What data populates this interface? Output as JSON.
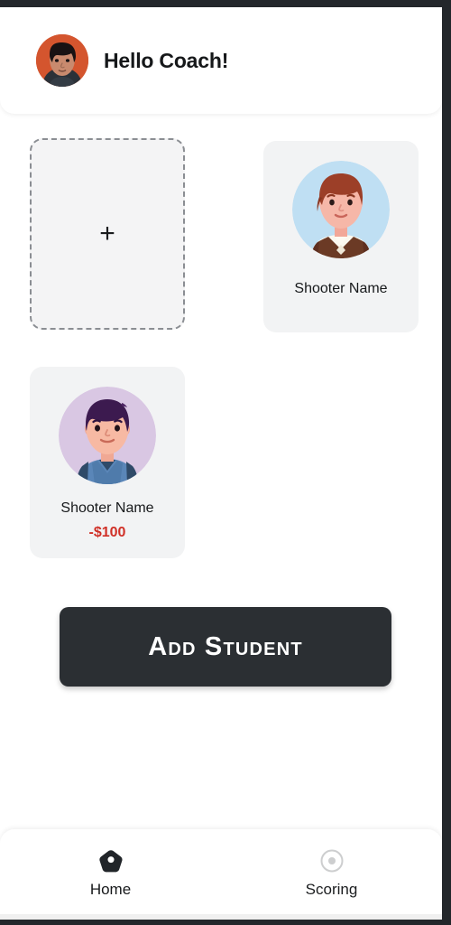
{
  "header": {
    "avatar_icon": "coach-photo-avatar",
    "greeting": "Hello Coach!"
  },
  "main": {
    "add_card": {
      "icon": "plus-icon",
      "label": "+"
    },
    "students": [
      {
        "avatar_icon": "student-avatar-boy-brown-hair",
        "name": "Shooter Name",
        "balance": ""
      },
      {
        "avatar_icon": "student-avatar-boy-purple-hair",
        "name": "Shooter Name",
        "balance": "-$100"
      }
    ],
    "add_student_button": "Add Student"
  },
  "bottom_nav": {
    "items": [
      {
        "label": "Home",
        "icon": "home-icon",
        "active": true
      },
      {
        "label": "Scoring",
        "icon": "target-icon",
        "active": false
      }
    ]
  },
  "colors": {
    "button_bg": "#2b2f33",
    "card_bg": "#f2f3f4",
    "negative_balance": "#d03027",
    "frame": "#23272b",
    "text_primary": "#17191b",
    "inactive_icon": "#c9cacc"
  }
}
